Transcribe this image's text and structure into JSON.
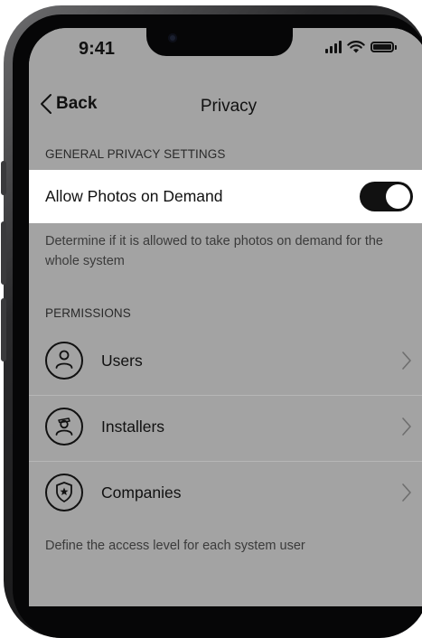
{
  "status_bar": {
    "time": "9:41"
  },
  "nav": {
    "back_label": "Back",
    "title": "Privacy"
  },
  "general": {
    "header": "GENERAL PRIVACY SETTINGS",
    "toggle_label": "Allow Photos on Demand",
    "toggle_on": true,
    "description": "Determine if it is allowed to take photos on demand for the whole system"
  },
  "permissions": {
    "header": "PERMISSIONS",
    "items": [
      {
        "label": "Users",
        "icon": "user-icon"
      },
      {
        "label": "Installers",
        "icon": "installer-icon"
      },
      {
        "label": "Companies",
        "icon": "company-shield-icon"
      }
    ],
    "description": "Define the access level for each system user"
  },
  "colors": {
    "background": "#a3a3a3",
    "row_background": "#ffffff",
    "toggle_on": "#111111",
    "text_primary": "#111111",
    "text_secondary": "#3b3b3b"
  }
}
